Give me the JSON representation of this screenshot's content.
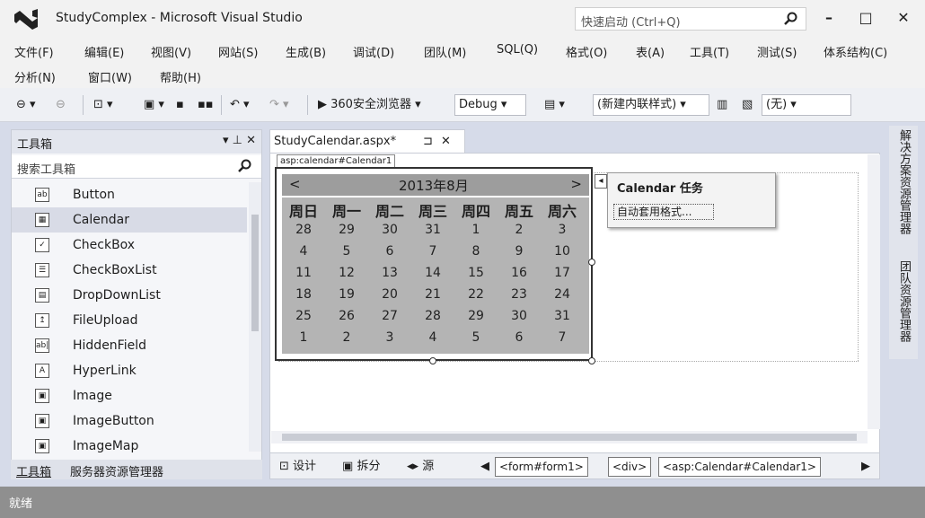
{
  "window": {
    "title": "StudyComplex - Microsoft Visual Studio",
    "quick_launch_placeholder": "快速启动 (Ctrl+Q)",
    "minimize": "–",
    "maximize": "□",
    "close": "✕"
  },
  "menu": [
    "文件(F)",
    "编辑(E)",
    "视图(V)",
    "网站(S)",
    "生成(B)",
    "调试(D)",
    "团队(M)",
    "SQL(Q)",
    "格式(O)",
    "表(A)",
    "工具(T)",
    "测试(S)",
    "体系结构(C)",
    "分析(N)",
    "窗口(W)",
    "帮助(H)"
  ],
  "toolbar": {
    "browser": "360安全浏览器",
    "config": "Debug",
    "style_rule": "(新建内联样式)",
    "target": "(无)"
  },
  "toolbox": {
    "title": "工具箱",
    "controls": "▾ ⊥ ✕",
    "search_placeholder": "搜索工具箱",
    "items": [
      "Button",
      "Calendar",
      "CheckBox",
      "CheckBoxList",
      "DropDownList",
      "FileUpload",
      "HiddenField",
      "HyperLink",
      "Image",
      "ImageButton",
      "ImageMap"
    ],
    "icons": [
      "ab",
      "▦",
      "✓",
      "☰",
      "▤",
      "↥",
      "ab|",
      "A",
      "▣",
      "▣",
      "▣"
    ],
    "selected_index": 1,
    "tabs": [
      "工具箱",
      "服务器资源管理器"
    ]
  },
  "document": {
    "tab_label": "StudyCalendar.aspx*",
    "tab_pin": "⊐",
    "tab_close": "✕",
    "control_tag": "asp:calendar#Calendar1"
  },
  "calendar": {
    "prev": "<",
    "next": ">",
    "caption": "2013年8月",
    "day_headers": [
      "周日",
      "周一",
      "周二",
      "周三",
      "周四",
      "周五",
      "周六"
    ],
    "weeks": [
      [
        "28",
        "29",
        "30",
        "31",
        "1",
        "2",
        "3"
      ],
      [
        "4",
        "5",
        "6",
        "7",
        "8",
        "9",
        "10"
      ],
      [
        "11",
        "12",
        "13",
        "14",
        "15",
        "16",
        "17"
      ],
      [
        "18",
        "19",
        "20",
        "21",
        "22",
        "23",
        "24"
      ],
      [
        "25",
        "26",
        "27",
        "28",
        "29",
        "30",
        "31"
      ],
      [
        "1",
        "2",
        "3",
        "4",
        "5",
        "6",
        "7"
      ]
    ]
  },
  "tasks": {
    "title": "Calendar 任务",
    "link": "自动套用格式..."
  },
  "viewbar": {
    "design": "设计",
    "split": "拆分",
    "source": "源",
    "crumbs": [
      "<form#form1>",
      "<div>",
      "<asp:Calendar#Calendar1>"
    ]
  },
  "right_panel": [
    "解决方案资源管理器",
    "团队资源管理器"
  ],
  "status": "就绪"
}
